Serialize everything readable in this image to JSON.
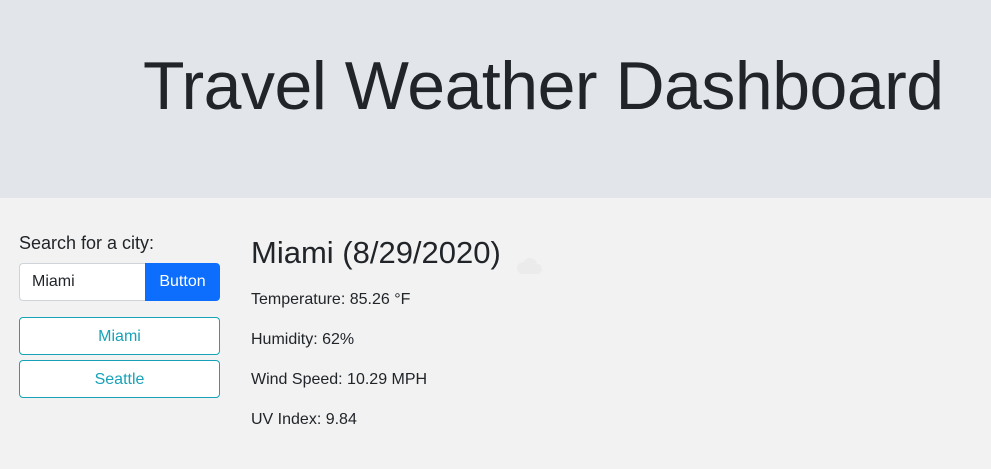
{
  "header": {
    "title": "Travel Weather Dashboard"
  },
  "sidebar": {
    "search_label": "Search for a city:",
    "search_value": "Miami",
    "search_button_label": "Button",
    "history": [
      {
        "label": "Miami"
      },
      {
        "label": "Seattle"
      }
    ]
  },
  "weather": {
    "city_heading": "Miami (8/29/2020)",
    "icon": "cloud-icon",
    "temperature": "Temperature: 85.26 °F",
    "humidity": "Humidity: 62%",
    "wind_speed": "Wind Speed: 10.29 MPH",
    "uv_index": "UV Index: 9.84"
  },
  "colors": {
    "header_bg": "#e2e6ea",
    "page_bg": "#f2f2f2",
    "primary": "#0d6efd",
    "info": "#17a2b8",
    "text": "#212529"
  }
}
